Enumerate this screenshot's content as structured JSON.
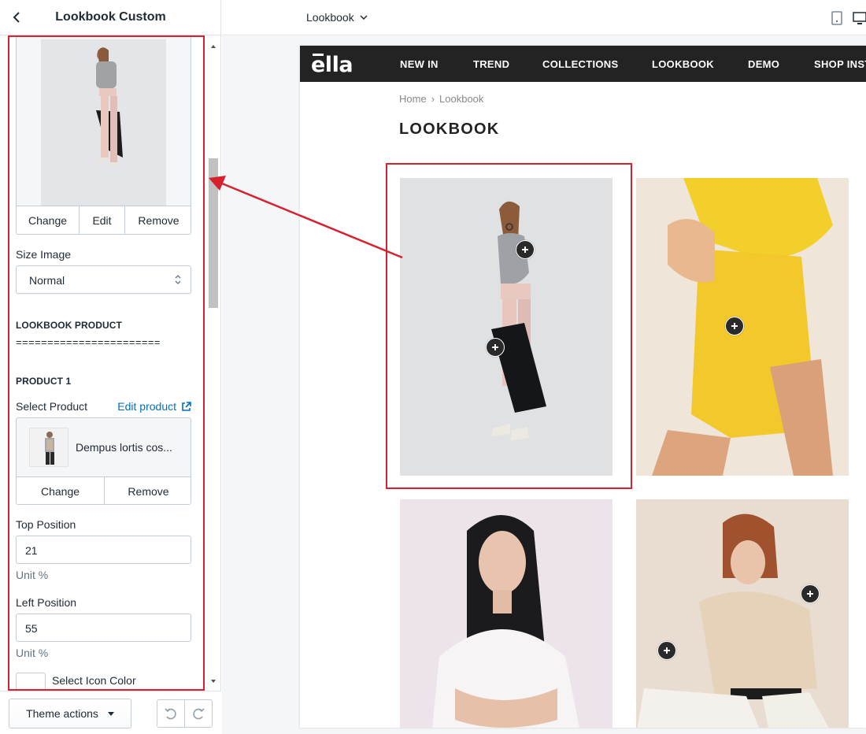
{
  "sidebar": {
    "title": "Lookbook Custom",
    "image_actions": {
      "change": "Change",
      "edit": "Edit",
      "remove": "Remove"
    },
    "size_image": {
      "label": "Size Image",
      "value": "Normal"
    },
    "lookbook_product_heading": "LOOKBOOK PRODUCT",
    "separator": "=======================",
    "product1": {
      "heading": "PRODUCT 1",
      "select_label": "Select Product",
      "edit_link": "Edit product",
      "product_name": "Dempus lortis cos...",
      "change": "Change",
      "remove": "Remove"
    },
    "top_position": {
      "label": "Top Position",
      "value": "21",
      "unit": "Unit %"
    },
    "left_position": {
      "label": "Left Position",
      "value": "55",
      "unit": "Unit %"
    },
    "icon_color": {
      "label": "Select Icon Color",
      "value": "#ffffff"
    },
    "footer": {
      "theme_actions": "Theme actions"
    }
  },
  "topbar": {
    "page_select": "Lookbook"
  },
  "store": {
    "logo": "ella",
    "nav": [
      "NEW IN",
      "TREND",
      "COLLECTIONS",
      "LOOKBOOK",
      "DEMO",
      "SHOP INSTA"
    ],
    "breadcrumb": {
      "home": "Home",
      "separator": "›",
      "current": "Lookbook"
    },
    "page_title": "LOOKBOOK"
  },
  "colors": {
    "highlight": "#d7212f",
    "nav_bg": "#232323",
    "link": "#006fbb",
    "device_active": "#5c6ac4"
  }
}
